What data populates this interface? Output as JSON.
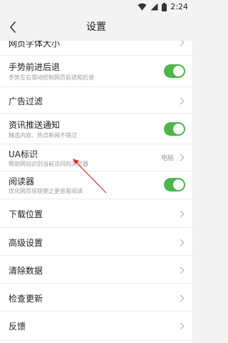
{
  "status": {
    "time": "2:24"
  },
  "header": {
    "title": "设置",
    "back_icon": "back-arrow-icon"
  },
  "items": [
    {
      "label": "网页字体大小",
      "type": "chevron"
    },
    {
      "label": "手势前进后退",
      "sub": "手势左右滑动控制网页前进和后退",
      "type": "toggle",
      "on": true
    },
    {
      "label": "广告过滤",
      "type": "chevron"
    },
    {
      "label": "资讯推送通知",
      "sub": "精选内容、热点新闻不错过",
      "type": "toggle",
      "on": true
    },
    {
      "label": "UA标识",
      "sub": "帮助网站识别当前访问的浏览器",
      "value": "电脑",
      "type": "chevron"
    },
    {
      "label": "阅读器",
      "sub": "优化网页排版使之更容易阅读",
      "type": "toggle",
      "on": true
    },
    {
      "label": "下载位置",
      "type": "chevron"
    },
    {
      "label": "高级设置",
      "type": "chevron"
    },
    {
      "label": "清除数据",
      "type": "chevron"
    },
    {
      "label": "检查更新",
      "type": "chevron"
    },
    {
      "label": "反馈",
      "type": "chevron"
    }
  ],
  "colors": {
    "toggle_on": "#4cb64a",
    "annotation_arrow": "#e03030"
  }
}
